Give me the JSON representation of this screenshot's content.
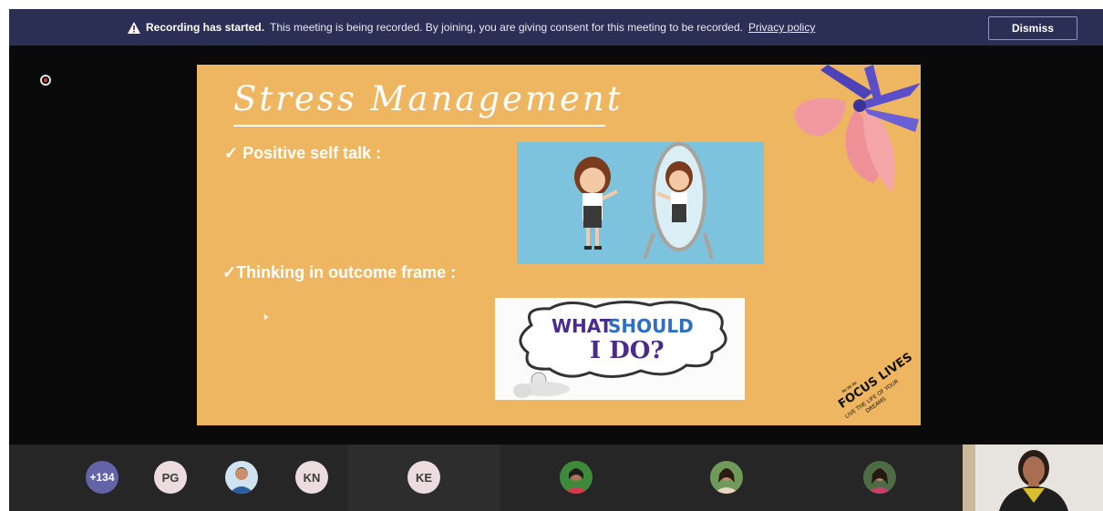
{
  "banner": {
    "title": "Recording has started.",
    "message": "This meeting is being recorded. By joining, you are giving consent for this meeting to be recorded.",
    "link": "Privacy policy",
    "dismiss_label": "Dismiss",
    "icon": "warning-icon"
  },
  "slide": {
    "title": "Stress Management",
    "bullets": [
      "✓ Positive self talk :",
      "✓Thinking in outcome frame :"
    ],
    "image_text": "WHAT SHOULD I DO?",
    "logo_text": "FOCUS LIVES",
    "logo_tagline": "LIVE THE LIFE OF YOUR DREAMS"
  },
  "participants": [
    {
      "type": "overflow",
      "label": "+134"
    },
    {
      "type": "initials",
      "label": "PG"
    },
    {
      "type": "photo",
      "label": ""
    },
    {
      "type": "initials",
      "label": "KN"
    },
    {
      "type": "initials",
      "label": "KE"
    },
    {
      "type": "photo",
      "label": ""
    },
    {
      "type": "photo",
      "label": ""
    },
    {
      "type": "photo",
      "label": ""
    }
  ],
  "colors": {
    "banner_bg": "#2b2e55",
    "slide_bg": "#efb661",
    "overflow_avatar": "#6264a7",
    "initials_avatar": "#ecdcdf"
  }
}
